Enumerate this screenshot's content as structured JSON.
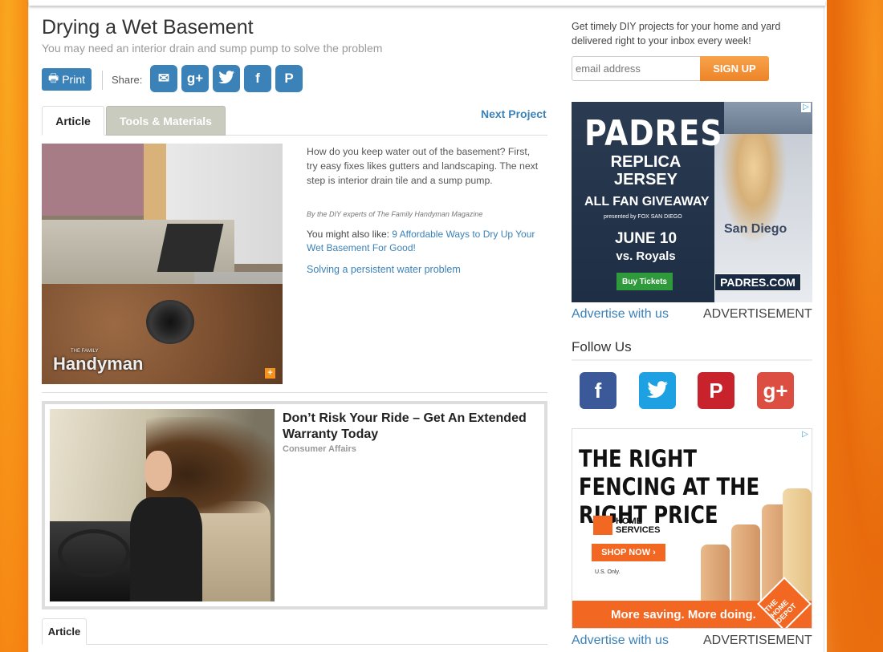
{
  "article": {
    "title": "Drying a Wet Basement",
    "subtitle": "You may need an interior drain and sump pump to solve the problem",
    "print_label": "Print",
    "share_label": "Share:",
    "share_buttons": [
      {
        "icon": "email-icon",
        "glyph": "✉"
      },
      {
        "icon": "google-plus-icon",
        "glyph": "g+"
      },
      {
        "icon": "twitter-icon",
        "glyph": "🐦"
      },
      {
        "icon": "facebook-icon",
        "glyph": "f"
      },
      {
        "icon": "pinterest-icon",
        "glyph": "P"
      }
    ],
    "tabs": [
      "Article",
      "Tools & Materials"
    ],
    "next_project": "Next Project",
    "image_logo": "Handyman",
    "image_logo_small": "THE FAMILY",
    "intro": "How do you keep water out of the basement? First, try easy fixes likes gutters and landscaping. The next step is interior drain tile and a sump pump.",
    "byline": "By the DIY experts of The Family Handyman Magazine",
    "also_prefix": "You might also like: ",
    "also_link": "9 Affordable Ways to Dry Up Your Wet Basement For Good!",
    "solving_link": "Solving a persistent water problem",
    "bottom_tab": "Article"
  },
  "sponsored": {
    "title": "Don’t Risk Your Ride – Get An Extended Warranty Today",
    "source": "Consumer Affairs"
  },
  "sidebar": {
    "newsletter_text": "Get timely DIY projects for your home and yard delivered right to your inbox every week!",
    "email_placeholder": "email address",
    "signup_label": "SIGN UP",
    "advertise_link": "Advertise with us",
    "advertisement_label": "ADVERTISEMENT",
    "follow_title": "Follow Us",
    "follow_icons": [
      "facebook-icon",
      "twitter-icon",
      "pinterest-icon",
      "google-plus-icon"
    ]
  },
  "ad_padres": {
    "brand": "PADRES",
    "line1": "REPLICA JERSEY",
    "line2": "ALL FAN GIVEAWAY",
    "presented": "presented by FOX SAN DIEGO",
    "date": "JUNE 10",
    "opponent": "vs. Royals",
    "cta": "Buy Tickets",
    "jersey_text": "San Diego",
    "url": "PADRES.COM"
  },
  "ad_homedepot": {
    "headline": "THE RIGHT FENCING AT THE RIGHT PRICE",
    "service": "HOME SERVICES",
    "cta": "SHOP NOW ›",
    "note": "U.S. Only.",
    "tagline": "More saving. More doing.",
    "logo": "THE HOME DEPOT"
  },
  "colors": {
    "accent": "#3b82b8",
    "signup": "#ee8427",
    "facebook": "#3b5998",
    "twitter": "#1da1e2",
    "pinterest": "#c8232c",
    "google_plus": "#dc4e41",
    "home_depot": "#f26722"
  }
}
